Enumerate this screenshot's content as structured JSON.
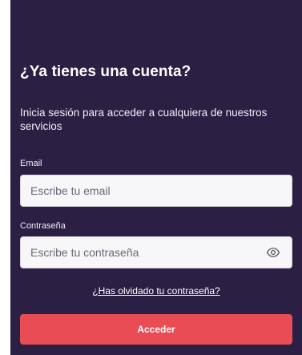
{
  "login": {
    "title": "¿Ya tienes una cuenta?",
    "subtitle": "Inicia sesión para acceder a cualquiera de nuestros servicios",
    "email_label": "Email",
    "email_placeholder": "Escribe tu email",
    "password_label": "Contraseña",
    "password_placeholder": "Escribe tu contraseña",
    "forgot_link": "¿Has olvidado tu contraseña?",
    "submit_label": "Acceder",
    "icons": {
      "password_toggle": "eye-icon"
    }
  },
  "colors": {
    "panel_bg": "#2b1f43",
    "button_bg": "#e84d55",
    "input_bg": "#f7f7f9"
  }
}
